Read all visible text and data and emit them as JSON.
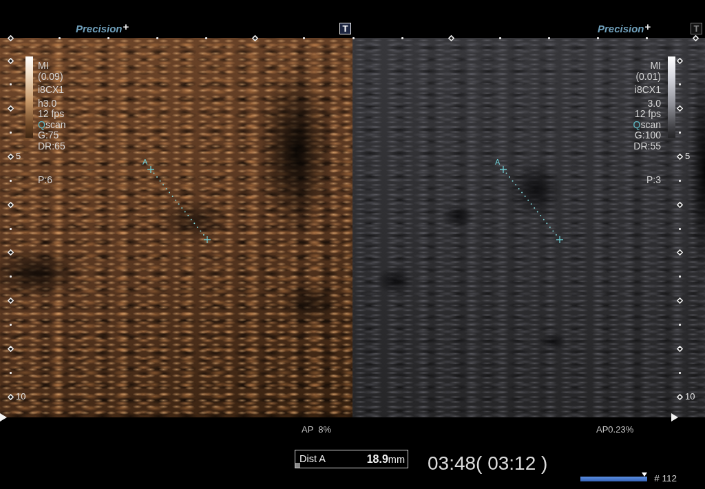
{
  "panels": [
    {
      "kind": "contrast",
      "brand_name": "Precision",
      "brand_suffix": "+",
      "t_toggle": {
        "label": "T",
        "active": true
      },
      "top_scale": [
        {
          "kind": "major"
        },
        {
          "kind": "minor"
        },
        {
          "kind": "minor"
        },
        {
          "kind": "minor"
        },
        {
          "kind": "minor"
        },
        {
          "kind": "major"
        },
        {
          "kind": "minor"
        }
      ],
      "depth_scale": [
        {
          "kind": "major"
        },
        {
          "kind": "minor"
        },
        {
          "kind": "major"
        },
        {
          "kind": "minor"
        },
        {
          "kind": "major",
          "label": "5"
        },
        {
          "kind": "minor"
        },
        {
          "kind": "major"
        },
        {
          "kind": "minor"
        },
        {
          "kind": "major"
        },
        {
          "kind": "minor"
        },
        {
          "kind": "major"
        },
        {
          "kind": "minor"
        },
        {
          "kind": "major"
        },
        {
          "kind": "minor"
        },
        {
          "kind": "major",
          "label": "10"
        }
      ],
      "labels": [
        [
          {
            "text": "MI"
          },
          {
            "text": "(0.09)"
          }
        ],
        [
          {
            "text": "i8CX1"
          }
        ],
        [
          {
            "text": "h3.0"
          },
          {
            "text": "12 fps"
          },
          {
            "accent": "Q",
            "text": "scan"
          },
          {
            "text": "G:75"
          },
          {
            "text": "DR:65"
          }
        ]
      ],
      "preset": "P:6",
      "caliper_label": "A",
      "ap": "AP  8%"
    },
    {
      "kind": "bmode",
      "brand_name": "Precision",
      "brand_suffix": "+",
      "t_toggle": {
        "label": "T",
        "active": false
      },
      "top_scale": [
        {
          "kind": "major"
        },
        {
          "kind": "minor"
        },
        {
          "kind": "minor"
        },
        {
          "kind": "minor"
        },
        {
          "kind": "minor"
        },
        {
          "kind": "major"
        },
        {
          "kind": "minor"
        },
        {
          "kind": "minor"
        }
      ],
      "depth_scale": [
        {
          "kind": "major"
        },
        {
          "kind": "minor"
        },
        {
          "kind": "major"
        },
        {
          "kind": "minor"
        },
        {
          "kind": "major",
          "label": "5"
        },
        {
          "kind": "minor"
        },
        {
          "kind": "major"
        },
        {
          "kind": "minor"
        },
        {
          "kind": "major"
        },
        {
          "kind": "minor"
        },
        {
          "kind": "major"
        },
        {
          "kind": "minor"
        },
        {
          "kind": "major"
        },
        {
          "kind": "minor"
        },
        {
          "kind": "major",
          "label": "10"
        }
      ],
      "labels": [
        [
          {
            "text": "MI"
          },
          {
            "text": "(0.01)"
          }
        ],
        [
          {
            "text": "i8CX1"
          }
        ],
        [
          {
            "text": "3.0"
          },
          {
            "text": "12 fps"
          },
          {
            "accent": "Q",
            "text": "scan"
          },
          {
            "text": "G:100"
          },
          {
            "text": "DR:55"
          }
        ]
      ],
      "preset": "P:3",
      "caliper_label": "A",
      "ap": "AP0.23%"
    }
  ],
  "measurement": {
    "label": "Dist A",
    "value": "**18.9**mm"
  },
  "timer": "03:48( 03:12 )",
  "cine": {
    "level": 1.0,
    "frame": "# 112"
  }
}
